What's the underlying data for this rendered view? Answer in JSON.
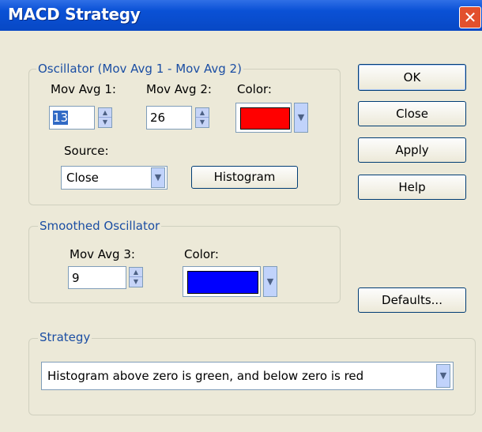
{
  "window": {
    "title": "MACD Strategy"
  },
  "oscillator": {
    "group_label": "Oscillator (Mov Avg 1 - Mov Avg 2)",
    "mov_avg1_label": "Mov Avg 1:",
    "mov_avg1_value": "13",
    "mov_avg2_label": "Mov Avg 2:",
    "mov_avg2_value": "26",
    "color_label": "Color:",
    "color_value": "#ff0000",
    "source_label": "Source:",
    "source_value": "Close",
    "histogram_label": "Histogram"
  },
  "smoothed": {
    "group_label": "Smoothed Oscillator",
    "mov_avg3_label": "Mov Avg 3:",
    "mov_avg3_value": "9",
    "color_label": "Color:",
    "color_value": "#0000ff"
  },
  "strategy": {
    "group_label": "Strategy",
    "selected": "Histogram above zero is green, and below zero is red"
  },
  "buttons": {
    "ok": "OK",
    "close": "Close",
    "apply": "Apply",
    "help": "Help",
    "defaults": "Defaults..."
  },
  "colors": {
    "titlebar": "#0a51d6",
    "dialog_bg": "#ece9d8",
    "group_label": "#1b4ea3",
    "close_button": "#e2502d"
  },
  "icons": {
    "close": "close-icon",
    "spin": "spin-arrows-icon",
    "dropdown": "chevron-down-icon"
  }
}
